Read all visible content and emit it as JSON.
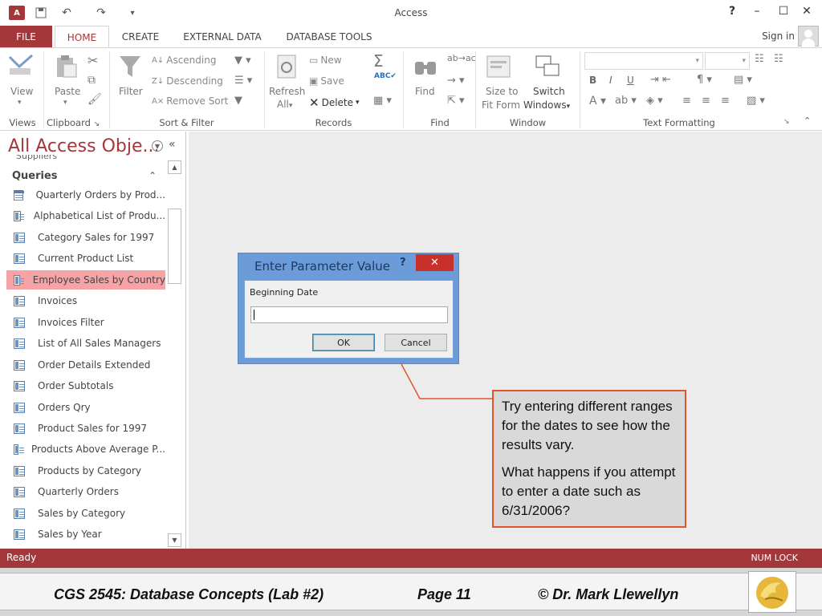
{
  "title_bar": {
    "app_icon": "A",
    "title": "Access",
    "help": "?",
    "minimize": "–",
    "maximize": "☐",
    "close": "✕"
  },
  "tabs": {
    "file": "FILE",
    "items": [
      "HOME",
      "CREATE",
      "EXTERNAL DATA",
      "DATABASE TOOLS"
    ],
    "active": "HOME",
    "sign_in": "Sign in"
  },
  "ribbon": {
    "views": {
      "view": "View",
      "label": "Views"
    },
    "clipboard": {
      "paste": "Paste",
      "label": "Clipboard"
    },
    "sort_filter": {
      "filter": "Filter",
      "ascending": "Ascending",
      "descending": "Descending",
      "remove_sort": "Remove Sort",
      "label": "Sort & Filter"
    },
    "records": {
      "refresh": "Refresh",
      "refresh_all": "All",
      "new": "New",
      "save": "Save",
      "delete": "Delete",
      "label": "Records"
    },
    "find": {
      "find": "Find",
      "label": "Find"
    },
    "window": {
      "size_to": "Size to",
      "fit_form": "Fit Form",
      "switch": "Switch",
      "windows": "Windows",
      "label": "Window"
    },
    "text_formatting": {
      "bold": "B",
      "italic": "I",
      "underline": "U",
      "label": "Text Formatting"
    }
  },
  "nav_pane": {
    "title": "All Access Obje...",
    "previous_item": "Suppliers",
    "group": "Queries",
    "items": [
      {
        "label": "Quarterly Orders by Prod...",
        "type": "table"
      },
      {
        "label": "Alphabetical List of Produ...",
        "type": "query"
      },
      {
        "label": "Category Sales for 1997",
        "type": "query"
      },
      {
        "label": "Current Product List",
        "type": "query"
      },
      {
        "label": "Employee Sales by Country",
        "type": "query",
        "selected": true
      },
      {
        "label": "Invoices",
        "type": "query"
      },
      {
        "label": "Invoices Filter",
        "type": "query"
      },
      {
        "label": "List of All Sales Managers",
        "type": "query"
      },
      {
        "label": "Order Details Extended",
        "type": "query"
      },
      {
        "label": "Order Subtotals",
        "type": "query"
      },
      {
        "label": "Orders Qry",
        "type": "query"
      },
      {
        "label": "Product Sales for 1997",
        "type": "query"
      },
      {
        "label": "Products Above Average P...",
        "type": "query"
      },
      {
        "label": "Products by Category",
        "type": "query"
      },
      {
        "label": "Quarterly Orders",
        "type": "query"
      },
      {
        "label": "Sales by Category",
        "type": "query"
      },
      {
        "label": "Sales by Year",
        "type": "query"
      }
    ]
  },
  "dialog": {
    "title": "Enter Parameter Value",
    "help": "?",
    "close": "✕",
    "prompt": "Beginning Date",
    "value": "",
    "ok": "OK",
    "cancel": "Cancel"
  },
  "callout": {
    "line1": "Try entering different ranges for the dates to see how the results vary.",
    "line2": "What happens if you attempt to enter a date such as 6/31/2006?"
  },
  "status_bar": {
    "status": "Ready",
    "num_lock": "NUM LOCK"
  },
  "footer": {
    "course": "CGS 2545: Database Concepts  (Lab #2)",
    "page": "Page 11",
    "author": "© Dr. Mark Llewellyn"
  },
  "colors": {
    "accent": "#a4373a",
    "dialog_frame": "#6b9bd8",
    "callout_border": "#e0542e",
    "selected_item": "#f6a3a6"
  }
}
